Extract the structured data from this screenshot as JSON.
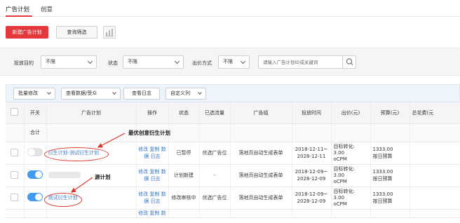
{
  "tabs": [
    "广告计划",
    "创意"
  ],
  "actions": {
    "new_plan": "新建广告计划",
    "query_filter": "查询筛选",
    "chart_icon": "bar-chart-icon"
  },
  "filters": {
    "purpose_label": "投放目的",
    "purpose_value": "不限",
    "status_label": "状态",
    "status_value": "不限",
    "bid_label": "出价方式",
    "bid_value": "不限",
    "search_placeholder": "请输入广告计划ID或关键词",
    "search_icon": "search-icon"
  },
  "toolbar": {
    "batch_edit": "批量修改",
    "view_data": "查看数据/受众",
    "view_log": "查看日志",
    "custom_columns": "自定义列"
  },
  "columns": [
    "开关",
    "广告计划",
    "操作",
    "状态",
    "已选流量",
    "广告组",
    "投放时间",
    "出价(元)",
    "预算(元)",
    "总花费(元"
  ],
  "total_label": "合计",
  "rows": [
    {
      "toggle_on": false,
      "plan": "衍生计划-测试衍生计划",
      "ops": [
        "修改",
        "复制",
        "数",
        "据",
        "日志"
      ],
      "status": "已暂停",
      "traffic": "优选广告位",
      "group": "落地页自动生成表单",
      "time": [
        "2018-12-11~",
        "2028-12-11"
      ],
      "bid": [
        "目标转化:",
        "3.00",
        "oCPM"
      ],
      "budget": [
        "1333.00",
        "按日预算"
      ]
    },
    {
      "toggle_on": true,
      "plan": "",
      "ops": [
        "修改",
        "复制",
        "数",
        "据",
        "日志"
      ],
      "status": "计划新建",
      "traffic": "-",
      "group": "落地页自动生成表单",
      "time": [
        "2018-12-09~",
        "2028-12-09"
      ],
      "bid": [
        "目标转化:",
        "3.00",
        "oCPM"
      ],
      "budget": [
        "1333.00",
        "按日预算"
      ]
    },
    {
      "toggle_on": true,
      "plan": "测试衍生计划",
      "ops": [
        "修改",
        "复制",
        "数",
        "据",
        "日志"
      ],
      "status": "修改审核中",
      "traffic": "优选广告位",
      "group": "落地页自动生成表单",
      "time": [
        "2018-12-09~",
        "2028-12-09"
      ],
      "bid": [
        "目标转化:",
        "3.00",
        "oCPM"
      ],
      "budget": [
        "1333.00",
        "按日预算"
      ]
    }
  ],
  "partial_ops": [
    "修改",
    "复制",
    "数"
  ],
  "annotations": {
    "derived_plan": "最优创意衍生计划",
    "source_plan": "源计划"
  },
  "colors": {
    "accent_red": "#e4393c",
    "link_blue": "#3a78c3",
    "toggle_on": "#3e9bf0",
    "annotation_red": "#d9362c"
  }
}
